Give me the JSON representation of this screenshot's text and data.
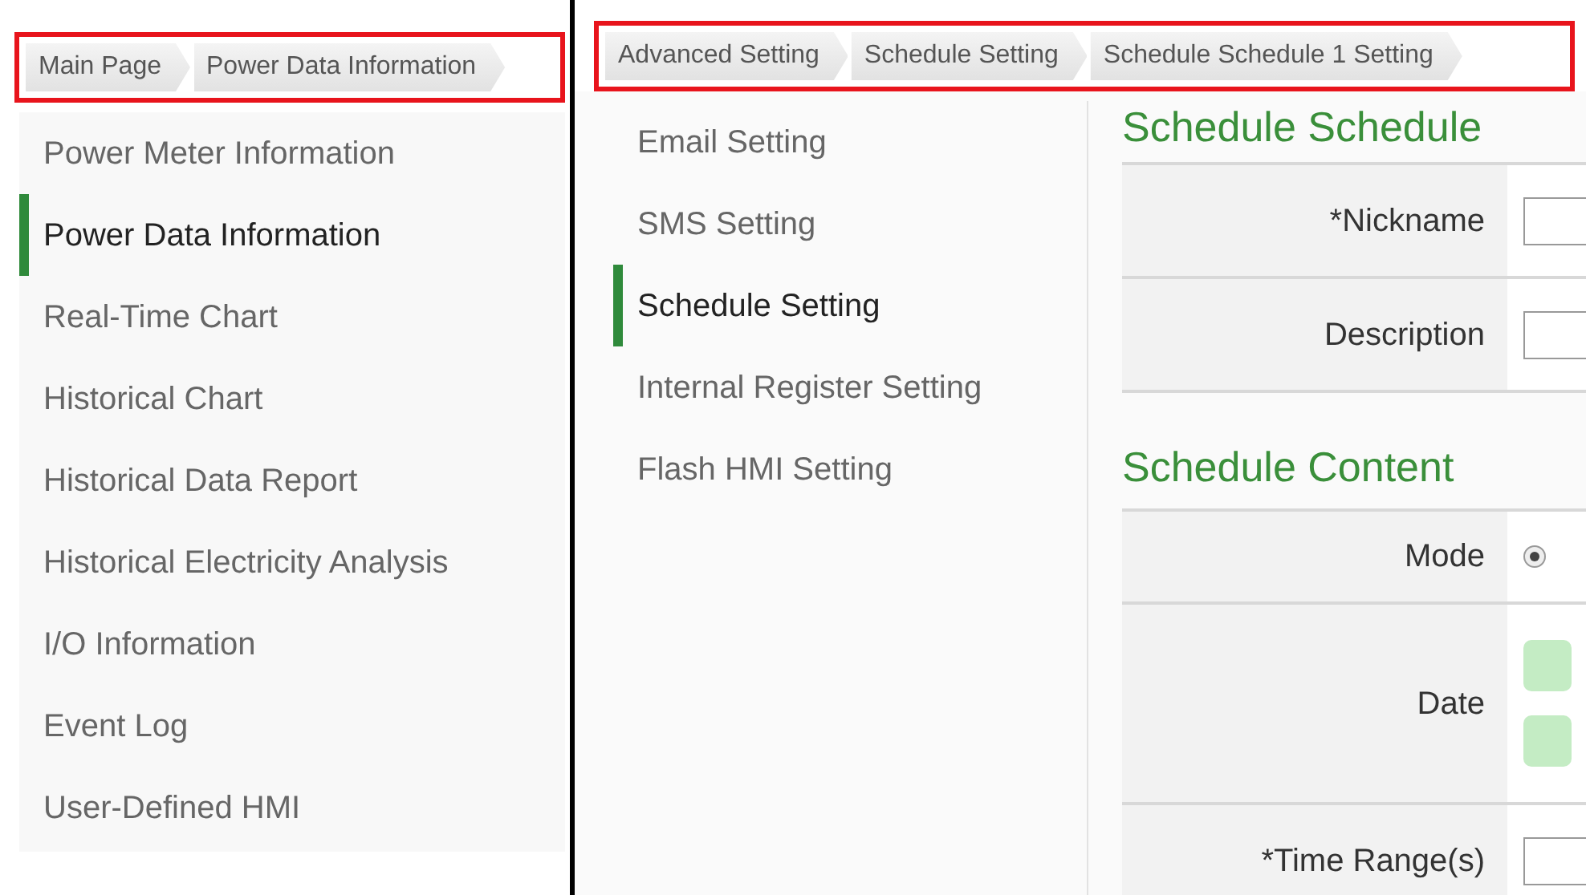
{
  "left_panel": {
    "breadcrumb": [
      "Main Page",
      "Power Data Information"
    ],
    "menu": [
      {
        "label": "Power Meter Information",
        "selected": false
      },
      {
        "label": "Power Data Information",
        "selected": true
      },
      {
        "label": "Real-Time Chart",
        "selected": false
      },
      {
        "label": "Historical Chart",
        "selected": false
      },
      {
        "label": "Historical Data Report",
        "selected": false
      },
      {
        "label": "Historical Electricity Analysis",
        "selected": false
      },
      {
        "label": "I/O Information",
        "selected": false
      },
      {
        "label": "Event Log",
        "selected": false
      },
      {
        "label": "User-Defined HMI",
        "selected": false
      }
    ]
  },
  "right_panel": {
    "breadcrumb": [
      "Advanced Setting",
      "Schedule Setting",
      "Schedule Schedule 1 Setting"
    ],
    "menu": [
      {
        "label": "Email Setting",
        "selected": false
      },
      {
        "label": "SMS Setting",
        "selected": false
      },
      {
        "label": "Schedule Setting",
        "selected": true
      },
      {
        "label": "Internal Register Setting",
        "selected": false
      },
      {
        "label": "Flash HMI Setting",
        "selected": false
      }
    ],
    "sections": [
      {
        "title": "Schedule Schedule",
        "rows": [
          {
            "label": "*Nickname",
            "kind": "input"
          },
          {
            "label": "Description",
            "kind": "input"
          }
        ]
      },
      {
        "title": "Schedule Content",
        "rows": [
          {
            "label": "Mode",
            "kind": "radio",
            "selected": true
          },
          {
            "label": "Date",
            "kind": "dates"
          },
          {
            "label": "*Time Range(s)",
            "kind": "input"
          }
        ]
      }
    ]
  }
}
